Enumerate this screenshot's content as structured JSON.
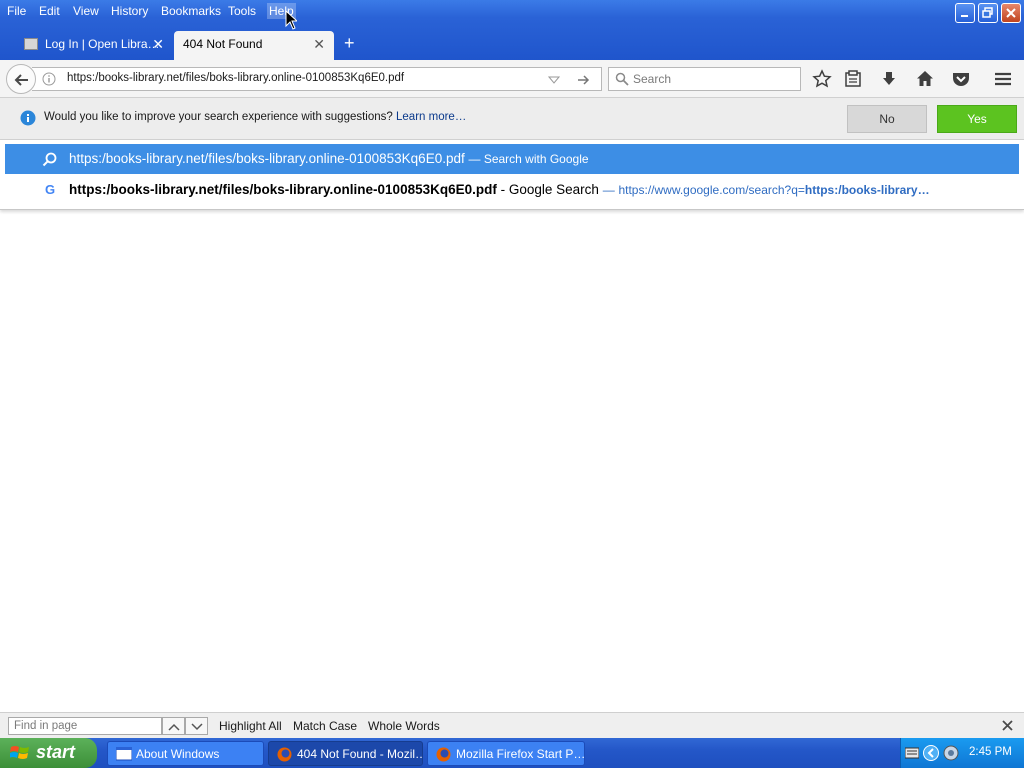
{
  "menu": [
    "File",
    "Edit",
    "View",
    "History",
    "Bookmarks",
    "Tools",
    "Help"
  ],
  "tabs": [
    {
      "label": "Log In | Open Libra…"
    },
    {
      "label": "404 Not Found"
    }
  ],
  "navbar": {
    "url": "https:/books-library.net/files/boks-library.online-0100853Kq6E0.pdf",
    "search_placeholder": "Search"
  },
  "notification": {
    "text": "Would you like to improve your search experience with suggestions?",
    "link": "Learn more…",
    "no_label": "No",
    "yes_label": "Yes"
  },
  "autocomplete": {
    "row1_text": "https:/books-library.net/files/boks-library.online-0100853Kq6E0.pdf",
    "row1_suffix": "— Search with Google",
    "row2_text": "https:/books-library.net/files/boks-library.online-0100853Kq6E0.pdf",
    "row2_suffix": "- Google Search",
    "row2_dash": "—",
    "row2_url_plain": "https://www.google.com/search?q=",
    "row2_url_bold": "https:/books-library…"
  },
  "findbar": {
    "placeholder": "Find in page",
    "highlight_all": "Highlight All",
    "match_case": "Match Case",
    "whole_words": "Whole Words"
  },
  "taskbar": {
    "start": "start",
    "tasks": [
      "About Windows",
      "404 Not Found - Mozil…",
      "Mozilla Firefox Start P…"
    ],
    "clock": "2:45 PM"
  },
  "colors": {
    "titlebar": "#2a62d6",
    "autocomplete_highlight": "#3d8ee5",
    "yes_button": "#5cc320",
    "taskbar": "#2457c8"
  }
}
